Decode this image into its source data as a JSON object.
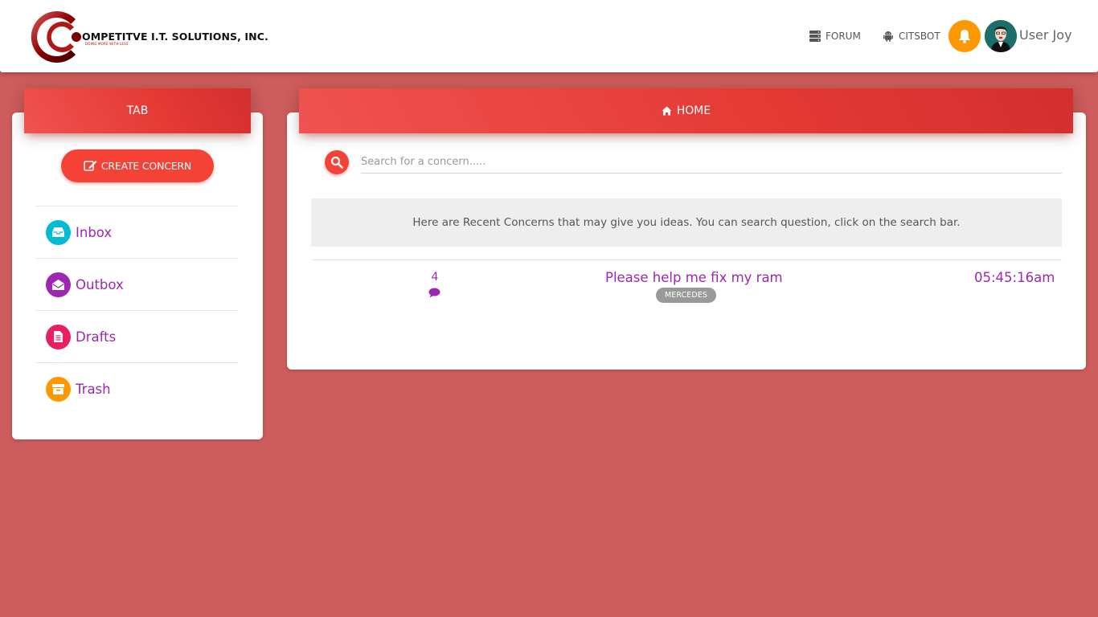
{
  "brand": {
    "name": "OMPETITVE I.T. SOLUTIONS, INC.",
    "tagline": "DOING MORE WITH LESS"
  },
  "navbar": {
    "forum_label": "FORUM",
    "citsbot_label": "CITSBOT",
    "user_name": "User Joy",
    "icons": {
      "forum": "server-icon",
      "citsbot": "android-icon",
      "notifications": "bell-icon"
    }
  },
  "sidebar": {
    "header": "TAB",
    "create_button_label": "CREATE CONCERN",
    "items": [
      {
        "label": "Inbox",
        "icon": "inbox-icon",
        "color": "#00bcd4"
      },
      {
        "label": "Outbox",
        "icon": "envelope-open-icon",
        "color": "#9c27b0"
      },
      {
        "label": "Drafts",
        "icon": "document-icon",
        "color": "#e91e63"
      },
      {
        "label": "Trash",
        "icon": "archive-icon",
        "color": "#ff9800"
      }
    ]
  },
  "main": {
    "header": "HOME",
    "search": {
      "placeholder": "Search for a concern.....",
      "value": ""
    },
    "info_text": "Here are Recent Concerns that may give you ideas. You can search question, click on the search bar.",
    "concerns": [
      {
        "reply_count": "4",
        "title": "Please help me fix my ram",
        "tag": "MERCEDES",
        "time": "05:45:16am"
      }
    ]
  },
  "colors": {
    "background": "#cd5c5c",
    "accent": "#f44336",
    "link": "#9c27b0",
    "bell": "#ff9800"
  }
}
